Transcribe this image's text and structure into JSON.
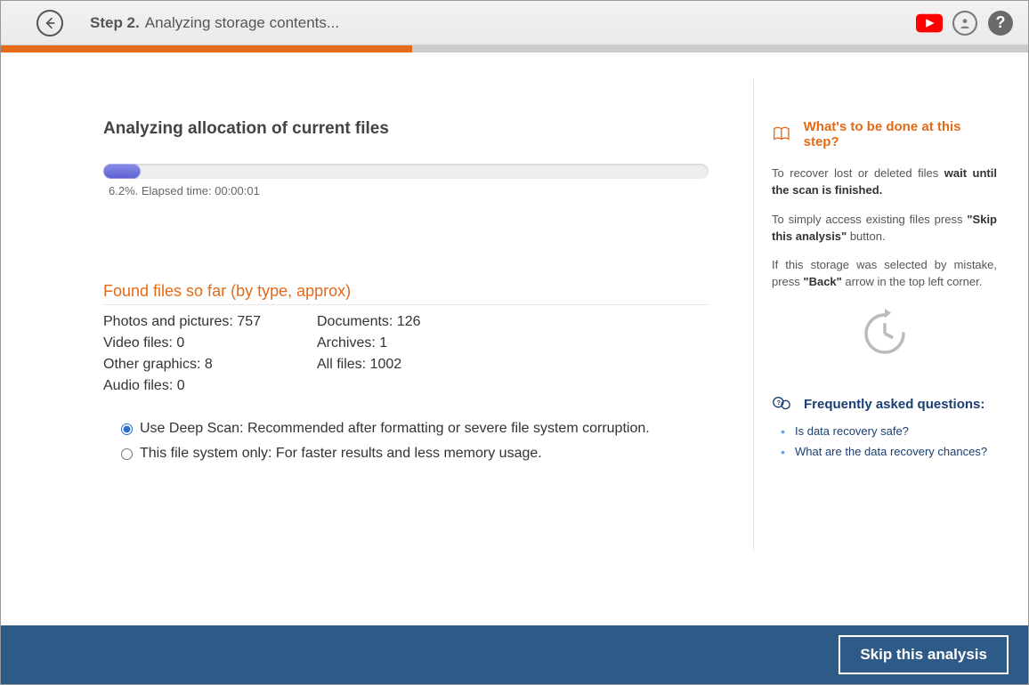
{
  "header": {
    "step_label": "Step 2.",
    "step_title": "Analyzing storage contents..."
  },
  "progress": {
    "heading": "Analyzing allocation of current files",
    "percent": 6.2,
    "status_text": "6.2%. Elapsed time: 00:00:01"
  },
  "found": {
    "heading": "Found files so far (by type, approx)",
    "items": {
      "photos": "Photos and pictures: 757",
      "documents": "Documents: 126",
      "video": "Video files: 0",
      "archives": "Archives: 1",
      "other": "Other graphics: 8",
      "all": "All files: 1002",
      "audio": "Audio files: 0"
    }
  },
  "scan_options": {
    "deep": "Use Deep Scan: Recommended after formatting or severe file system corruption.",
    "fs_only": "This file system only: For faster results and less memory usage."
  },
  "help": {
    "heading": "What's to be done at this step?",
    "p1a": "To recover lost or deleted files ",
    "p1b": "wait until the scan is finished.",
    "p2a": "To simply access existing files press ",
    "p2b": "\"Skip this analysis\"",
    "p2c": " button.",
    "p3a": "If this storage was selected by mistake, press ",
    "p3b": "\"Back\"",
    "p3c": " arrow in the top left corner."
  },
  "faq": {
    "heading": "Frequently asked questions:",
    "q1": "Is data recovery safe?",
    "q2": "What are the data recovery chances?"
  },
  "footer": {
    "skip_label": "Skip this analysis"
  }
}
